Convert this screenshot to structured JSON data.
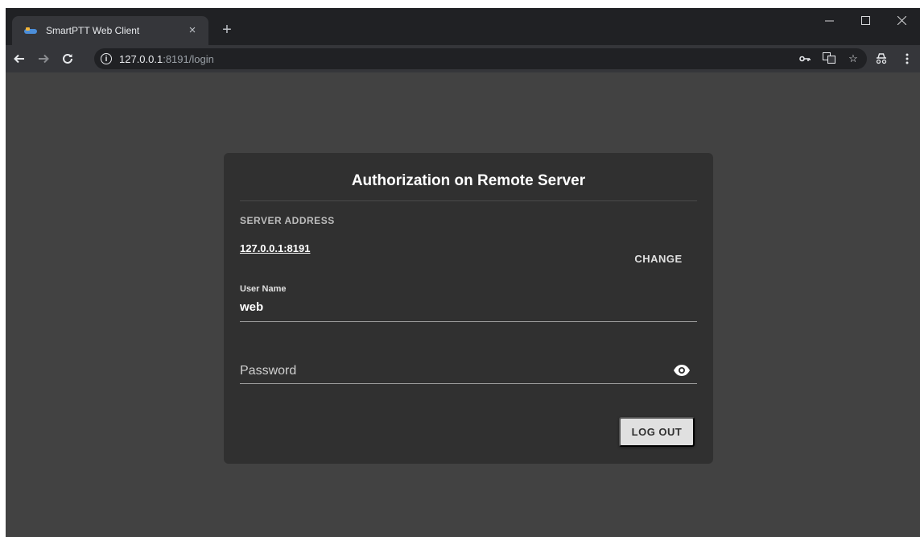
{
  "browser": {
    "tab_title": "SmartPTT Web Client",
    "tab_close": "×",
    "new_tab": "+",
    "url_host": "127.0.0.1",
    "url_rest": ":8191/login"
  },
  "login_card": {
    "title": "Authorization on Remote Server",
    "server_section_label": "SERVER ADDRESS",
    "server_address": "127.0.0.1:8191",
    "change_label": "CHANGE",
    "username_label": "User Name",
    "username_value": "web",
    "password_placeholder": "Password",
    "logout_label": "LOG OUT"
  },
  "colors": {
    "page_background": "#424242",
    "card_background": "#303030",
    "button_background": "#e0e0e0"
  }
}
